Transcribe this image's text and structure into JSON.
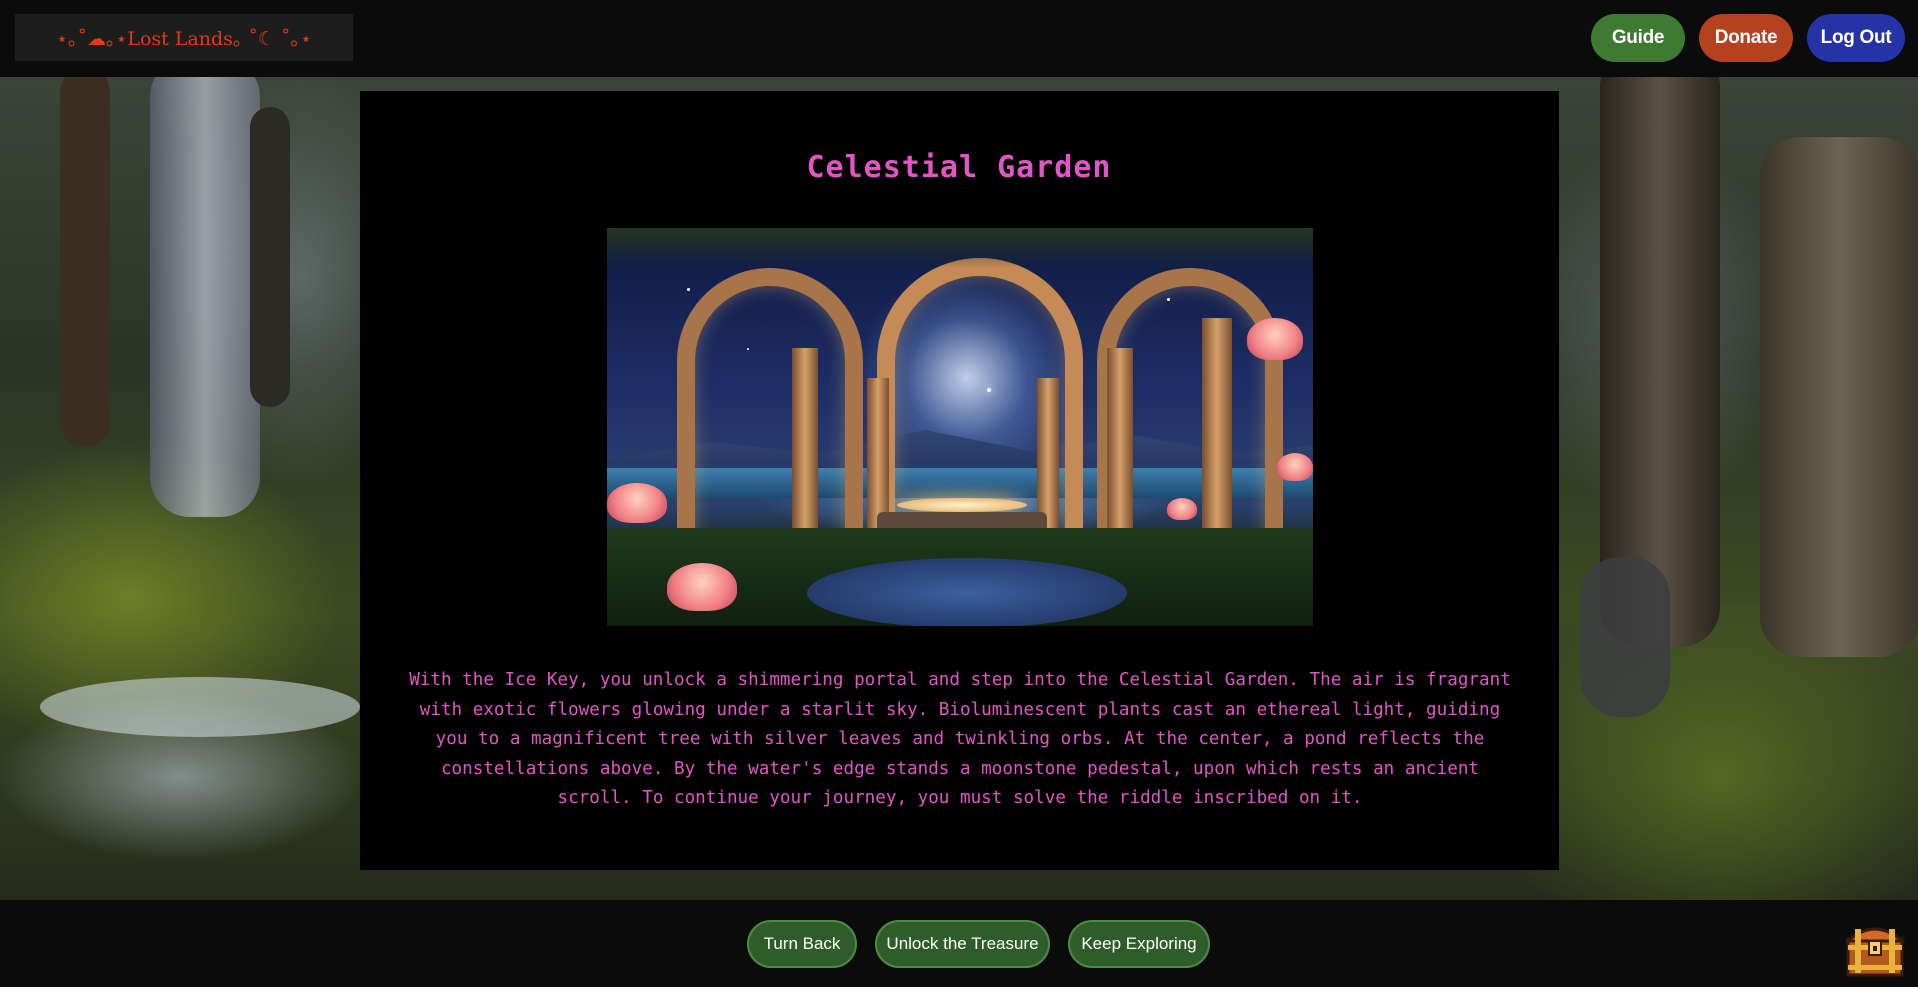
{
  "header": {
    "logo_text": "⋆｡˚☁︎｡⋆Lost Lands｡ ˚☾ ˚｡⋆",
    "buttons": [
      {
        "label": "Guide",
        "color": "#3f7a33"
      },
      {
        "label": "Donate",
        "color": "#b6411f"
      },
      {
        "label": "Log Out",
        "color": "#2633a6"
      }
    ]
  },
  "main": {
    "title": "Celestial Garden",
    "description": "With the Ice Key, you unlock a shimmering portal and step into the Celestial Garden. The air is fragrant with exotic flowers glowing under a starlit sky. Bioluminescent plants cast an ethereal light, guiding you to a magnificent tree with silver leaves and twinkling orbs. At the center, a pond reflects the constellations above. By the water's edge stands a moonstone pedestal, upon which rests an ancient scroll. To continue your journey, you must solve the riddle inscribed on it.",
    "text_color": "#e255c4"
  },
  "footer": {
    "buttons": [
      {
        "label": "Turn Back"
      },
      {
        "label": "Unlock the Treasure"
      },
      {
        "label": "Keep Exploring"
      }
    ],
    "inventory_icon": "treasure-chest-icon"
  }
}
